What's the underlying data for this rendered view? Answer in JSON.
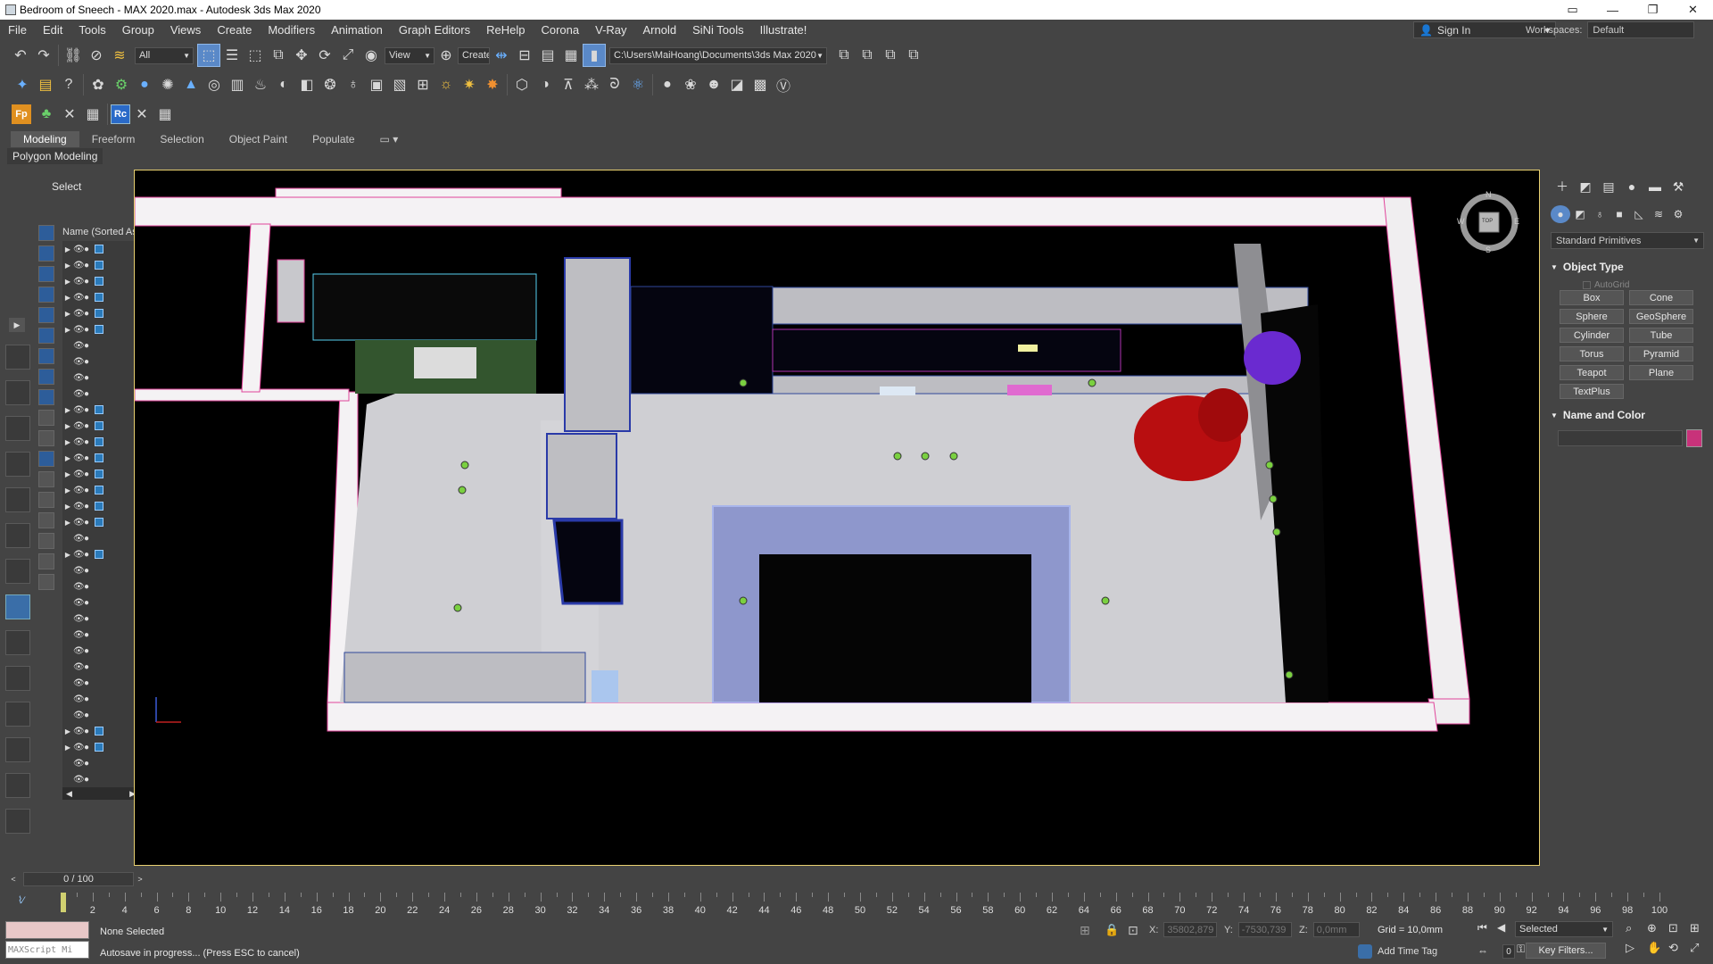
{
  "window": {
    "title": "Bedroom of Sneech - MAX 2020.max - Autodesk 3ds Max 2020",
    "controls": [
      "▭",
      "—",
      "❐",
      "✕"
    ]
  },
  "menu": [
    "File",
    "Edit",
    "Tools",
    "Group",
    "Views",
    "Create",
    "Modifiers",
    "Animation",
    "Graph Editors",
    "ReHelp",
    "Corona",
    "V-Ray",
    "Arnold",
    "SiNi Tools",
    "Illustrate!"
  ],
  "account": {
    "sign_in": "Sign In",
    "workspaces_label": "Workspaces:",
    "workspace": "Default"
  },
  "toolbar": {
    "filter": "All",
    "ref_coord": "View",
    "named_sel": "Create Selection Se",
    "project_path": "C:\\Users\\MaiHoang\\Documents\\3ds Max 2020"
  },
  "ribbon": {
    "tabs": [
      "Modeling",
      "Freeform",
      "Selection",
      "Object Paint",
      "Populate"
    ],
    "active_tab": "Modeling",
    "panel": "Polygon Modeling"
  },
  "scene_explorer": {
    "title": "Select",
    "column": "Name (Sorted Ascending)"
  },
  "viewcube": {
    "top": "TOP",
    "n": "N",
    "s": "S",
    "w": "W",
    "e": "E"
  },
  "command_panel": {
    "category": "Standard Primitives",
    "object_type": "Object Type",
    "autogrid": "AutoGrid",
    "primitives": [
      "Box",
      "Cone",
      "Sphere",
      "GeoSphere",
      "Cylinder",
      "Tube",
      "Torus",
      "Pyramid",
      "Teapot",
      "Plane",
      "TextPlus"
    ],
    "name_and_color": "Name and Color",
    "color": "#c8327a"
  },
  "timeline": {
    "frame": "0 / 100",
    "labels": [
      "0",
      "2",
      "4",
      "6",
      "8",
      "10",
      "12",
      "14",
      "16",
      "18",
      "20",
      "22",
      "24",
      "26",
      "28",
      "30",
      "32",
      "34",
      "36",
      "38",
      "40",
      "42",
      "44",
      "46",
      "48",
      "50",
      "52",
      "54",
      "56",
      "58",
      "60",
      "62",
      "64",
      "66",
      "68",
      "70",
      "72",
      "74",
      "76",
      "78",
      "80",
      "82",
      "84",
      "86",
      "88",
      "90",
      "92",
      "94",
      "96",
      "98",
      "100"
    ]
  },
  "status": {
    "maxscript": "MAXScript Mi",
    "selection": "None Selected",
    "prompt": "Autosave in progress... (Press ESC to cancel)",
    "x_label": "X:",
    "x_value": "35802,879",
    "y_label": "Y:",
    "y_value": "-7530,739",
    "z_label": "Z:",
    "z_value": "0,0mm",
    "grid": "Grid = 10,0mm",
    "add_time_tag": "Add Time Tag",
    "key_mode": "Selected",
    "key_filters": "Key Filters...",
    "frame_field": "0"
  }
}
